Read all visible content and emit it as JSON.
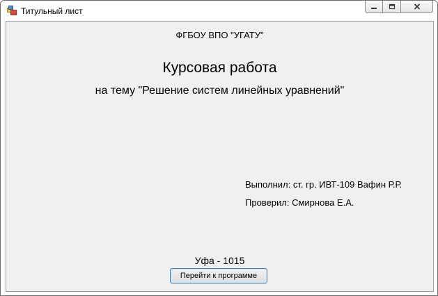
{
  "window": {
    "title": "Титульный лист",
    "icon": "app-form-icon",
    "controls": [
      "minimize-icon",
      "maximize-icon",
      "close-icon"
    ]
  },
  "content": {
    "organization": "ФГБОУ ВПО \"УГАТУ\"",
    "heading": "Курсовая работа",
    "topic": "на тему \"Решение систем линейных уравнений\"",
    "performed_by": "Выполнил: ст. гр. ИВТ-109 Вафин Р.Р.",
    "checked_by": "Проверил: Смирнова Е.А.",
    "city_year": "Уфа - 1015",
    "go_button_label": "Перейти к программе"
  }
}
